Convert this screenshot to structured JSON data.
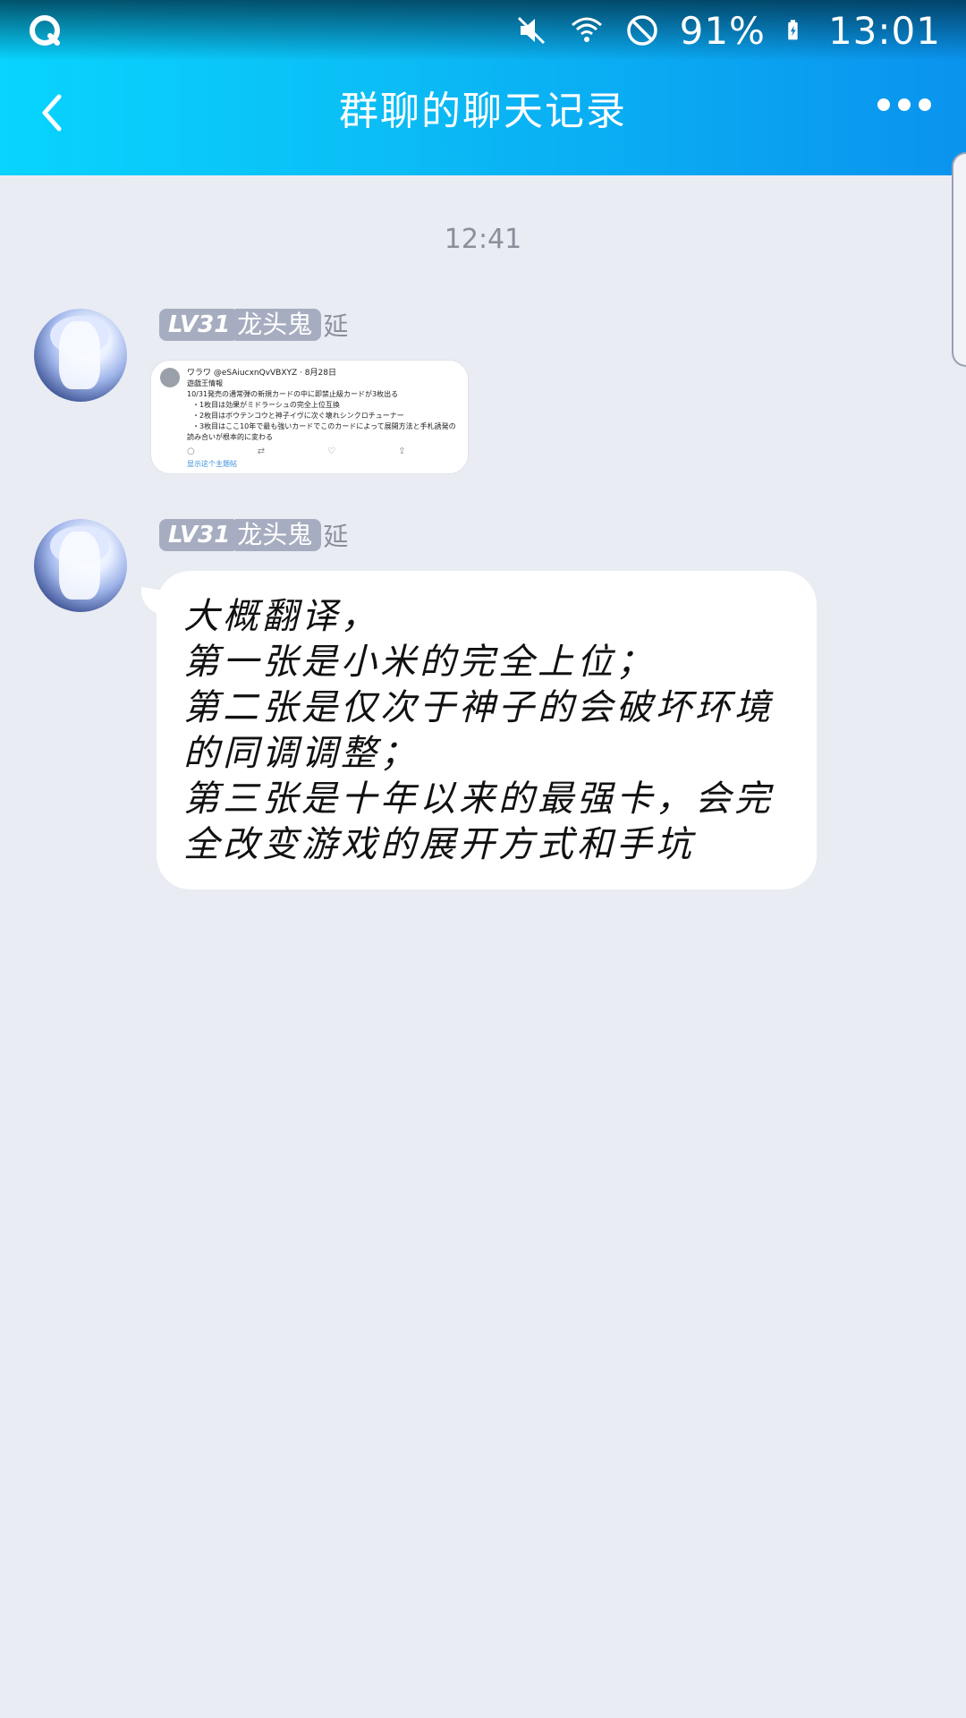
{
  "status_bar": {
    "battery": "91%",
    "time": "13:01",
    "icons": [
      "qq-app-icon",
      "mute-icon",
      "wifi-icon",
      "do-not-disturb-icon",
      "battery-charging-icon"
    ]
  },
  "header": {
    "title": "群聊的聊天记录",
    "back_icon": "chevron-left-icon",
    "more_icon": "more-dots-icon"
  },
  "chat": {
    "timestamp": "12:41",
    "messages": [
      {
        "level": "LV31",
        "sender": "龙头鬼",
        "sender_suffix": "延",
        "type": "image",
        "image_text": {
          "handle": "ワラワ @eSAiucxnQvVBXYZ · 8月28日",
          "line1": "遊戯王情報",
          "line2": "10/31発売の通常弾の新規カードの中に即禁止級カードが3枚出る",
          "line3": "・1枚目は効果がミドラーシュの完全上位互換",
          "line4": "・2枚目はボウテンコウと神子イヴに次ぐ壊れシンクロチューナー",
          "line5": "・3枚目はここ10年で最も強いカードでこのカードによって展開方法と手札誘発の",
          "line6": "読み合いが根本的に変わる",
          "footer": "显示这个主题帖"
        }
      },
      {
        "level": "LV31",
        "sender": "龙头鬼",
        "sender_suffix": "延",
        "type": "text",
        "lines": [
          "大概翻译，",
          "第一张是小米的完全上位；",
          "第二张是仅次于神子的会破坏环境",
          "的同调调整；",
          "第三张是十年以来的最强卡，会完",
          "全改变游戏的展开方式和手坑"
        ]
      }
    ]
  }
}
